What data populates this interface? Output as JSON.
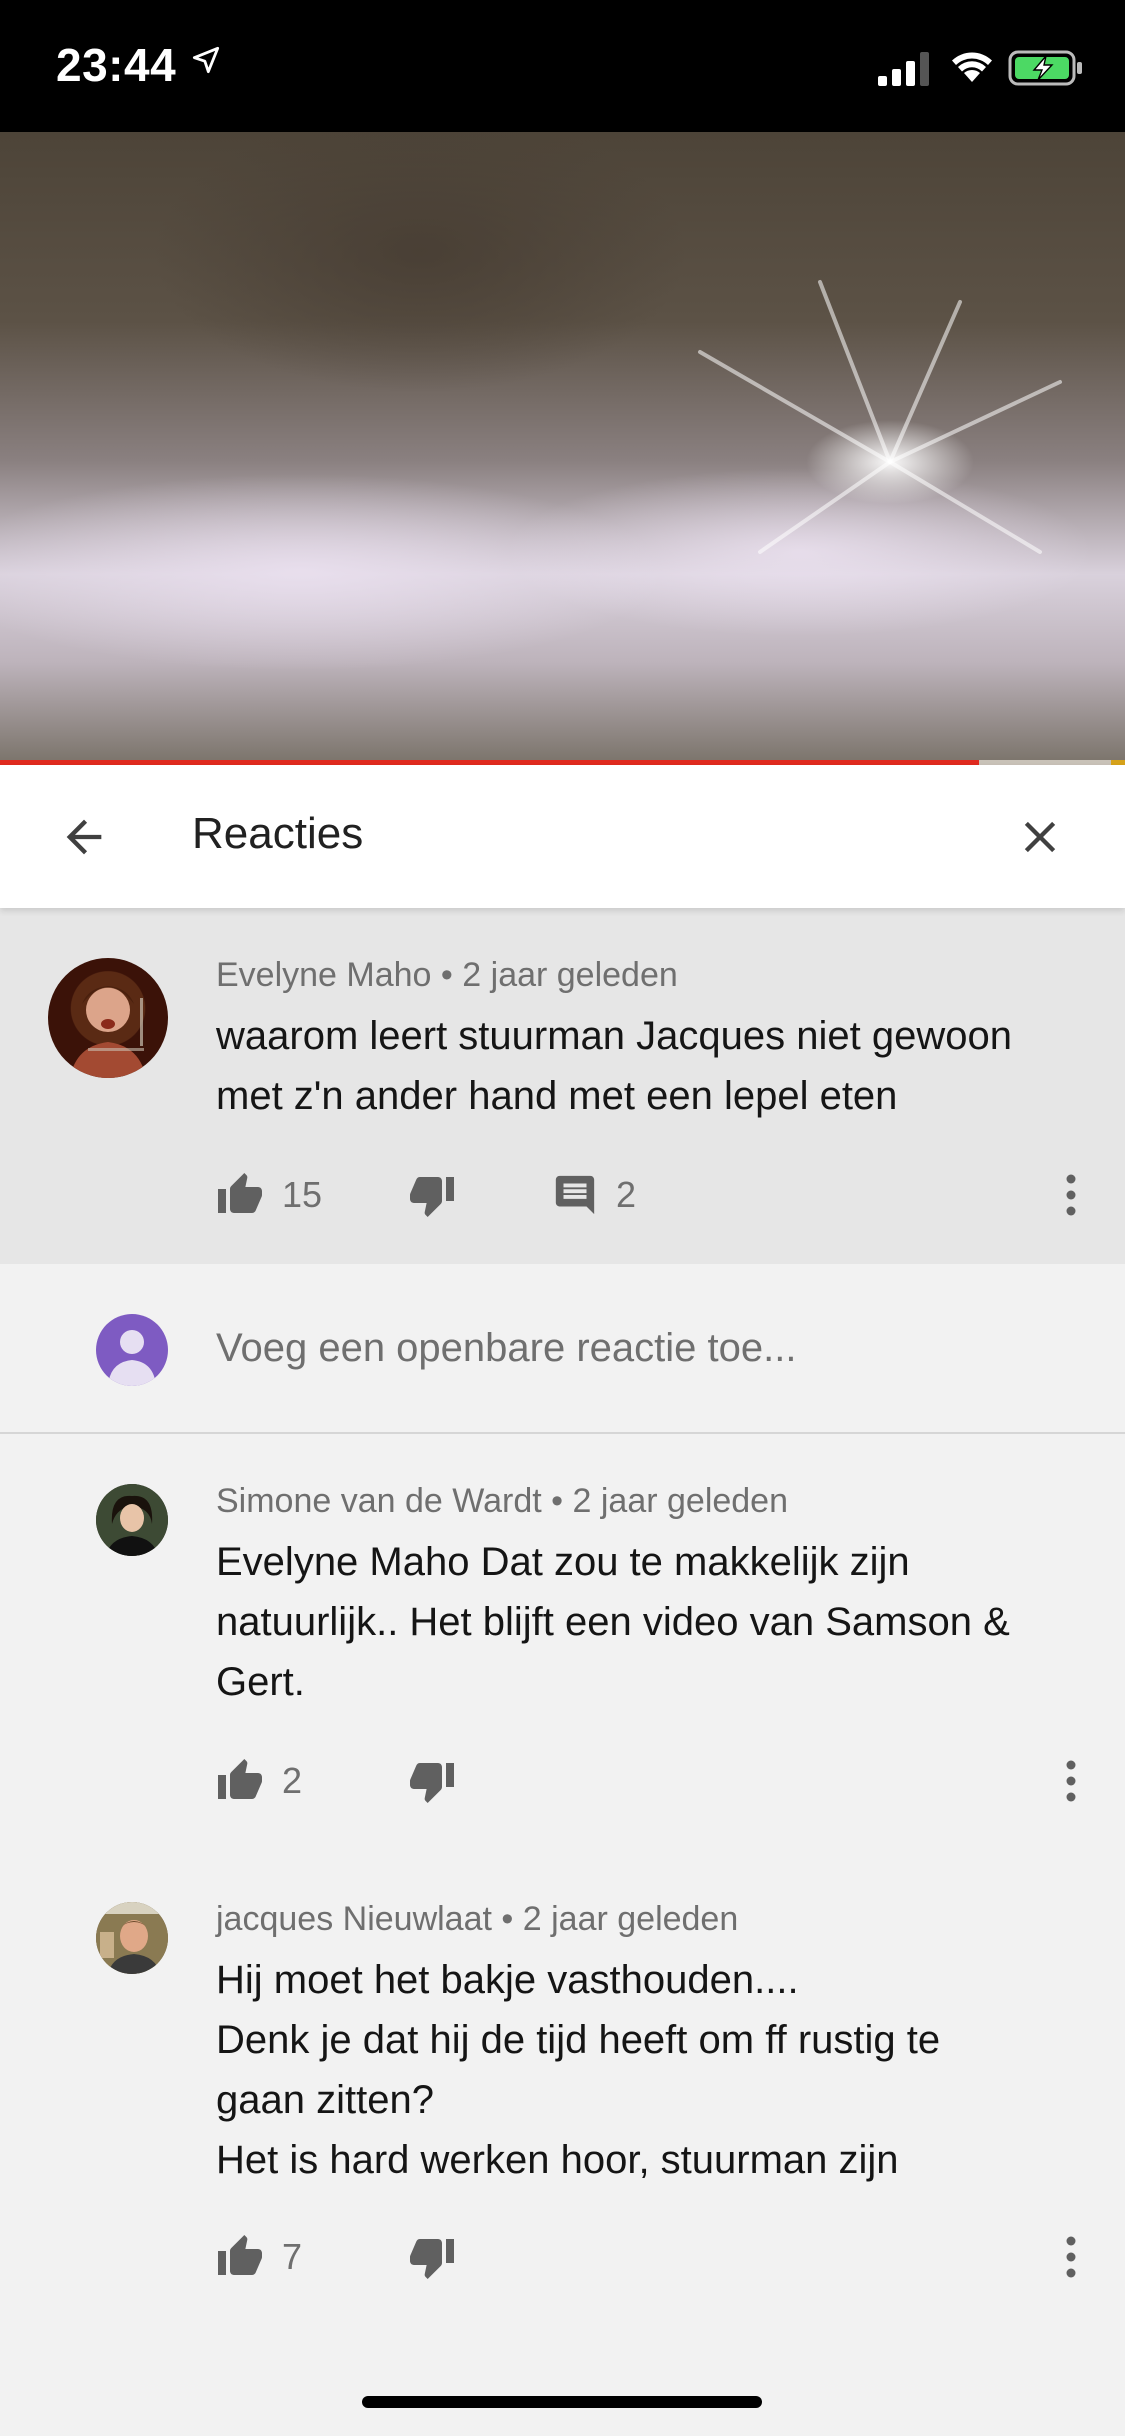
{
  "status_bar": {
    "time": "23:44",
    "icons": [
      "location-arrow-icon",
      "signal-icon",
      "wifi-icon",
      "battery-charging-icon"
    ]
  },
  "video": {
    "progress_percent": 87,
    "colors": {
      "played": "#e02a1f",
      "buffered": "#c9c2b8"
    }
  },
  "header": {
    "title": "Reacties",
    "back_icon": "arrow-left-icon",
    "close_icon": "close-icon"
  },
  "top_comment": {
    "author": "Evelyne Maho",
    "separator": "•",
    "time": "2 jaar geleden",
    "text_line1": "waarom leert stuurman Jacques niet gewoon",
    "text_line2": "met z'n ander hand met een lepel eten",
    "likes": "15",
    "replies": "2",
    "icons": [
      "thumb-up-icon",
      "thumb-down-icon",
      "comment-icon",
      "more-vert-icon"
    ]
  },
  "add_reply": {
    "placeholder": "Voeg een openbare reactie toe..."
  },
  "replies": [
    {
      "author": "Simone van de Wardt",
      "separator": "•",
      "time": "2 jaar geleden",
      "line1": "Evelyne Maho Dat zou te makkelijk zijn",
      "line2": "natuurlijk.. Het blijft een video van Samson &",
      "line3": "Gert.",
      "likes": "2"
    },
    {
      "author": "jacques Nieuwlaat",
      "separator": "•",
      "time": "2 jaar geleden",
      "line1": "Hij moet het bakje vasthouden....",
      "line2": "Denk je dat hij de tijd heeft om ff rustig te",
      "line3": "gaan zitten?",
      "line4": "Het is hard werken hoor, stuurman zijn",
      "likes": "7"
    }
  ],
  "accent_color": "#7e5bc2"
}
